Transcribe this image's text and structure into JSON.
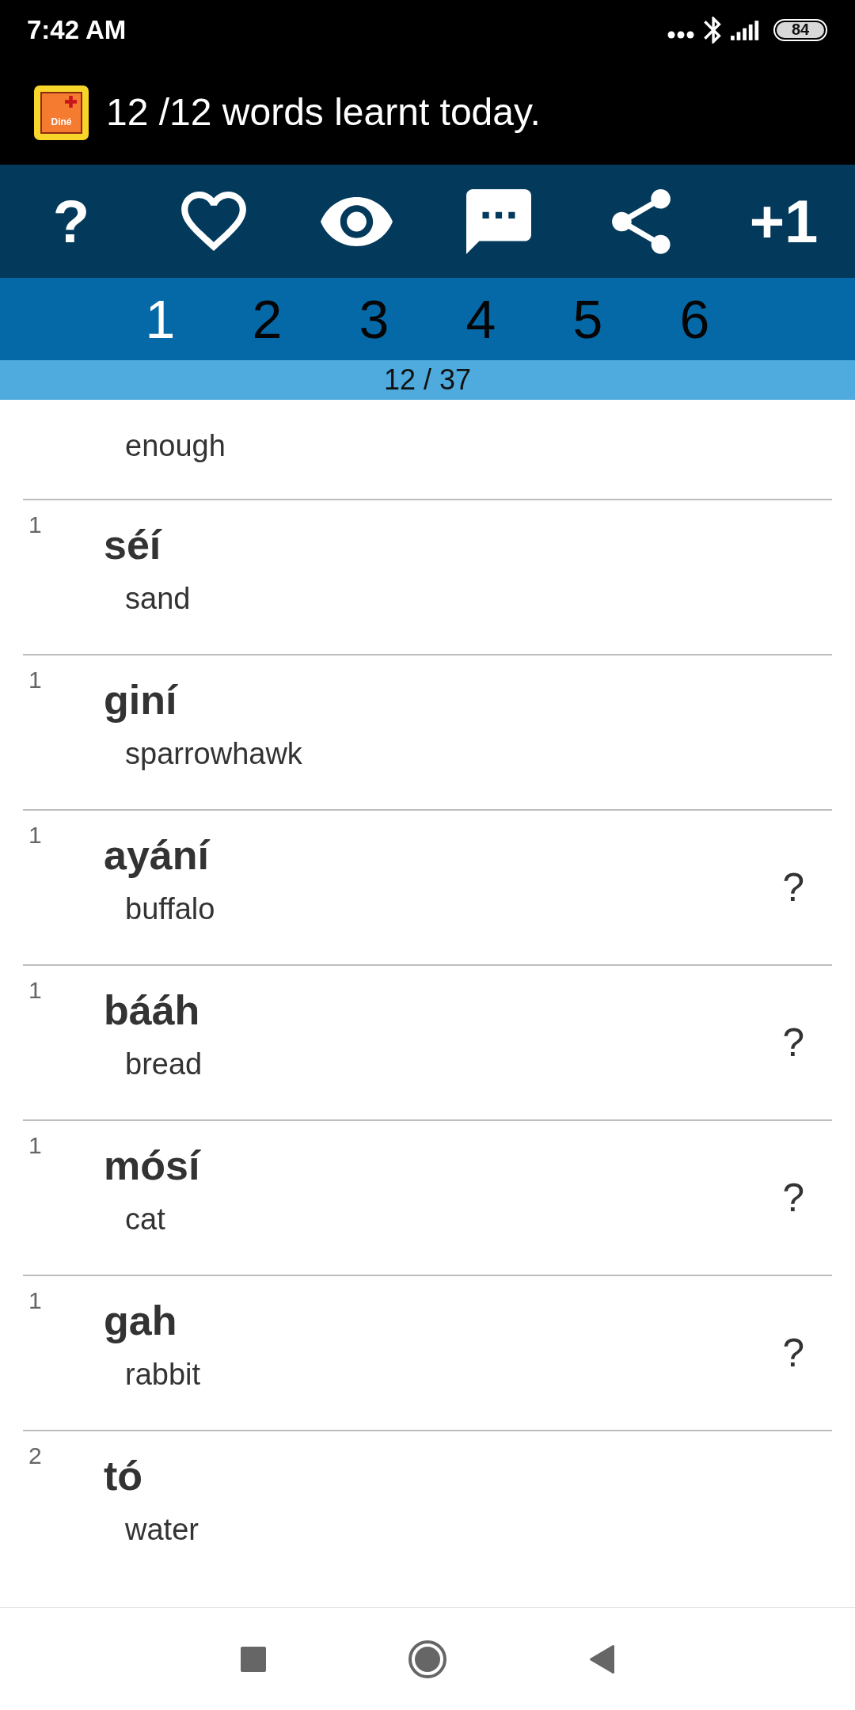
{
  "status_bar": {
    "time": "7:42 AM",
    "battery": "84"
  },
  "title_bar": {
    "app_icon_text": "Diné",
    "title": "12 /12 words learnt today."
  },
  "toolbar": [
    {
      "kind": "text",
      "label": "?"
    },
    {
      "kind": "favorite"
    },
    {
      "kind": "view"
    },
    {
      "kind": "comment"
    },
    {
      "kind": "share"
    },
    {
      "kind": "text",
      "label": "+1"
    }
  ],
  "tabs": [
    {
      "label": "1",
      "selected": true
    },
    {
      "label": "2",
      "selected": false
    },
    {
      "label": "3",
      "selected": false
    },
    {
      "label": "4",
      "selected": false
    },
    {
      "label": "5",
      "selected": false
    },
    {
      "label": "6",
      "selected": false
    }
  ],
  "counter": "12 / 37",
  "words": [
    {
      "translation": "enough"
    },
    {
      "count": "1",
      "word": "séí",
      "translation": "sand"
    },
    {
      "count": "1",
      "word": "giní",
      "translation": "sparrowhawk"
    },
    {
      "count": "1",
      "word": "ayání",
      "translation": "buffalo",
      "marker": "?"
    },
    {
      "count": "1",
      "word": "bááh",
      "translation": "bread",
      "marker": "?"
    },
    {
      "count": "1",
      "word": "mósí",
      "translation": "cat",
      "marker": "?"
    },
    {
      "count": "1",
      "word": "gah",
      "translation": "rabbit",
      "marker": "?"
    },
    {
      "count": "2",
      "word": "tó",
      "translation": "water"
    }
  ]
}
